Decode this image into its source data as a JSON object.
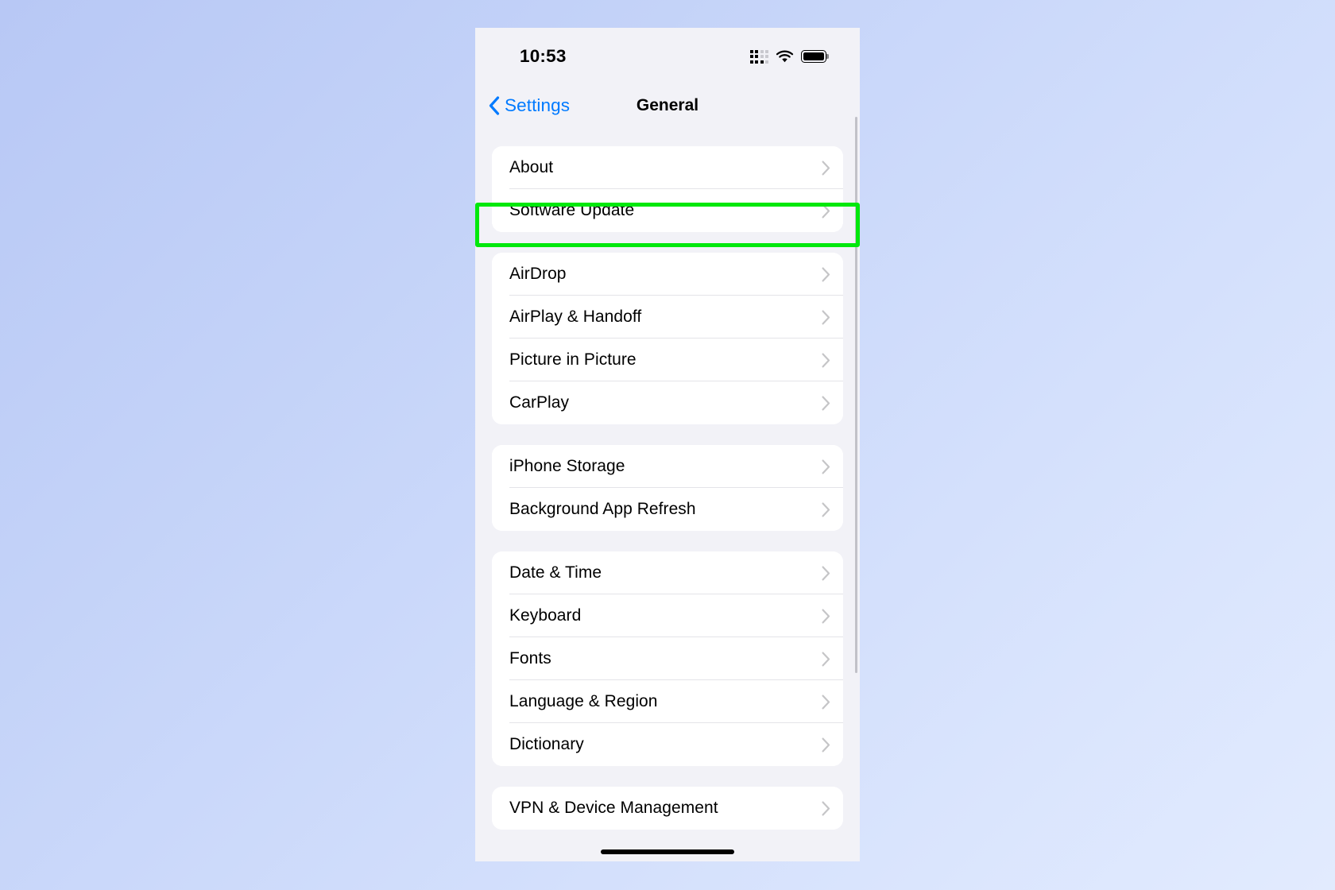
{
  "status_bar": {
    "time": "10:53",
    "cellular_icon": "cellular-signal-icon",
    "wifi_icon": "wifi-icon",
    "battery_icon": "battery-icon",
    "battery_level_percent": 100
  },
  "nav_bar": {
    "back_label": "Settings",
    "back_icon": "chevron-left-icon",
    "title": "General"
  },
  "colors": {
    "accent": "#007aff",
    "highlight": "#00e80c",
    "page_background": "#f2f2f7",
    "card_background": "#ffffff",
    "separator": "#e4e4e8",
    "chevron": "#c5c5c7",
    "desktop_background": "#c3d2f8"
  },
  "highlight": {
    "target_row": "Software Update",
    "color": "#00e80c"
  },
  "groups": [
    {
      "id": "group-info",
      "rows": [
        {
          "label": "About",
          "accessory": "chevron-right-icon"
        },
        {
          "label": "Software Update",
          "accessory": "chevron-right-icon"
        }
      ]
    },
    {
      "id": "group-connectivity",
      "rows": [
        {
          "label": "AirDrop",
          "accessory": "chevron-right-icon"
        },
        {
          "label": "AirPlay & Handoff",
          "accessory": "chevron-right-icon"
        },
        {
          "label": "Picture in Picture",
          "accessory": "chevron-right-icon"
        },
        {
          "label": "CarPlay",
          "accessory": "chevron-right-icon"
        }
      ]
    },
    {
      "id": "group-storage",
      "rows": [
        {
          "label": "iPhone Storage",
          "accessory": "chevron-right-icon"
        },
        {
          "label": "Background App Refresh",
          "accessory": "chevron-right-icon"
        }
      ]
    },
    {
      "id": "group-localization",
      "rows": [
        {
          "label": "Date & Time",
          "accessory": "chevron-right-icon"
        },
        {
          "label": "Keyboard",
          "accessory": "chevron-right-icon"
        },
        {
          "label": "Fonts",
          "accessory": "chevron-right-icon"
        },
        {
          "label": "Language & Region",
          "accessory": "chevron-right-icon"
        },
        {
          "label": "Dictionary",
          "accessory": "chevron-right-icon"
        }
      ]
    },
    {
      "id": "group-management",
      "rows": [
        {
          "label": "VPN & Device Management",
          "accessory": "chevron-right-icon"
        }
      ]
    }
  ]
}
